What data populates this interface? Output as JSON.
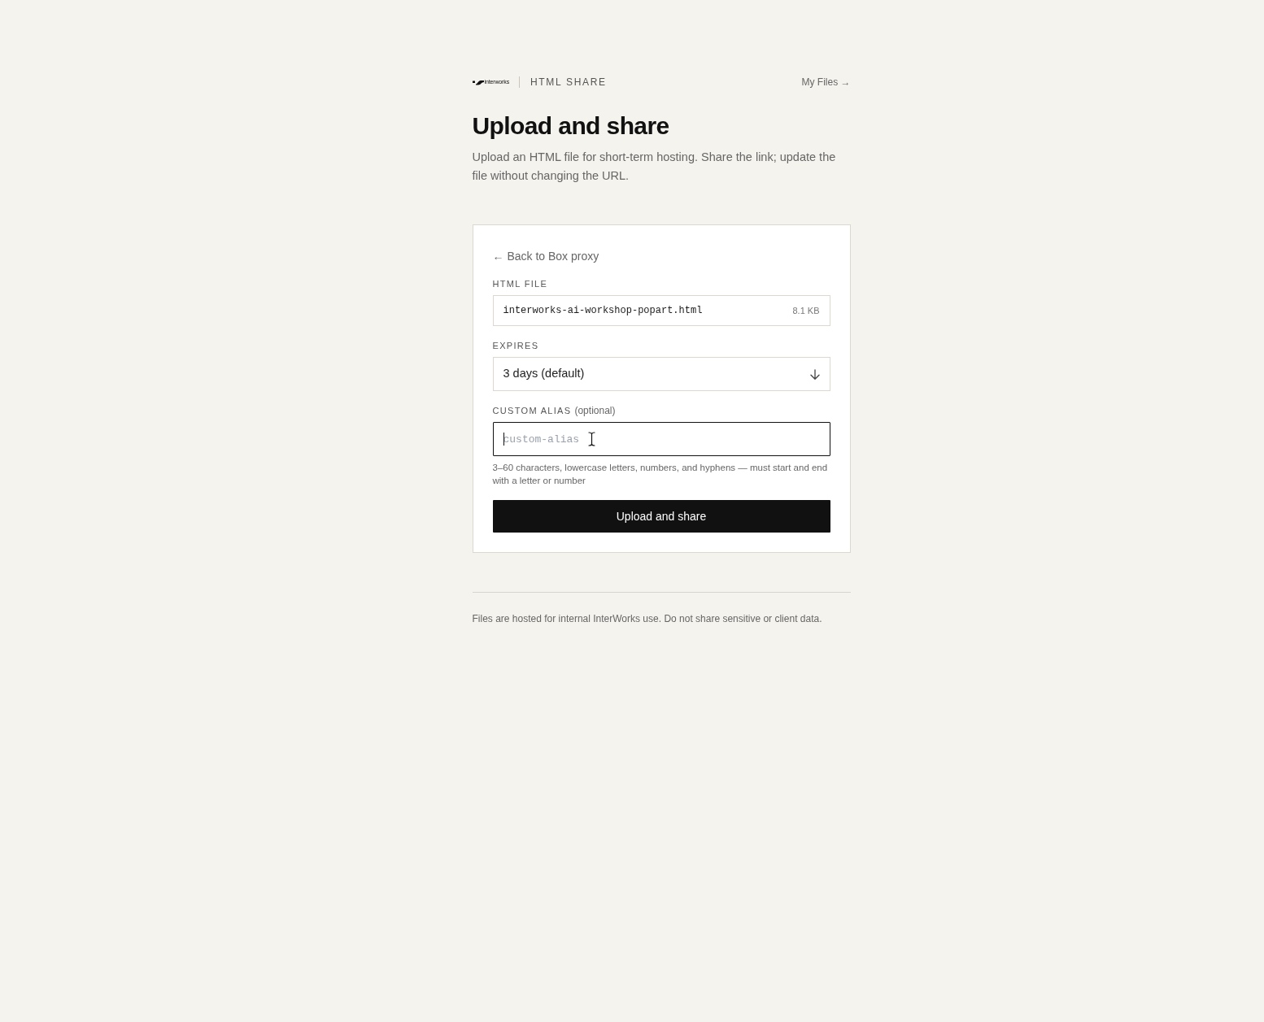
{
  "header": {
    "logo_text": "interworks",
    "app_name": "HTML SHARE",
    "nav_link": "My Files →"
  },
  "title": "Upload and share",
  "subtitle": "Upload an HTML file for short-term hosting. Share the link; update the file without changing the URL.",
  "form": {
    "back_link": "← Back to Box proxy",
    "fields": [
      {
        "kind": "file",
        "label": "HTML FILE",
        "value": "interworks-ai-workshop-popart.html",
        "size": "8.1 KB"
      },
      {
        "kind": "select",
        "label": "EXPIRES",
        "value": "3 days (default)"
      },
      {
        "kind": "text",
        "label": "CUSTOM ALIAS",
        "label_note": "(optional)",
        "placeholder": "custom-alias",
        "focused": true,
        "hint": "3–60 characters, lowercase letters, numbers, and hyphens — must start and end with a letter or number"
      }
    ],
    "submit": "Upload and share"
  },
  "footer": "Files are hosted for internal InterWorks use. Do not share sensitive or client data."
}
